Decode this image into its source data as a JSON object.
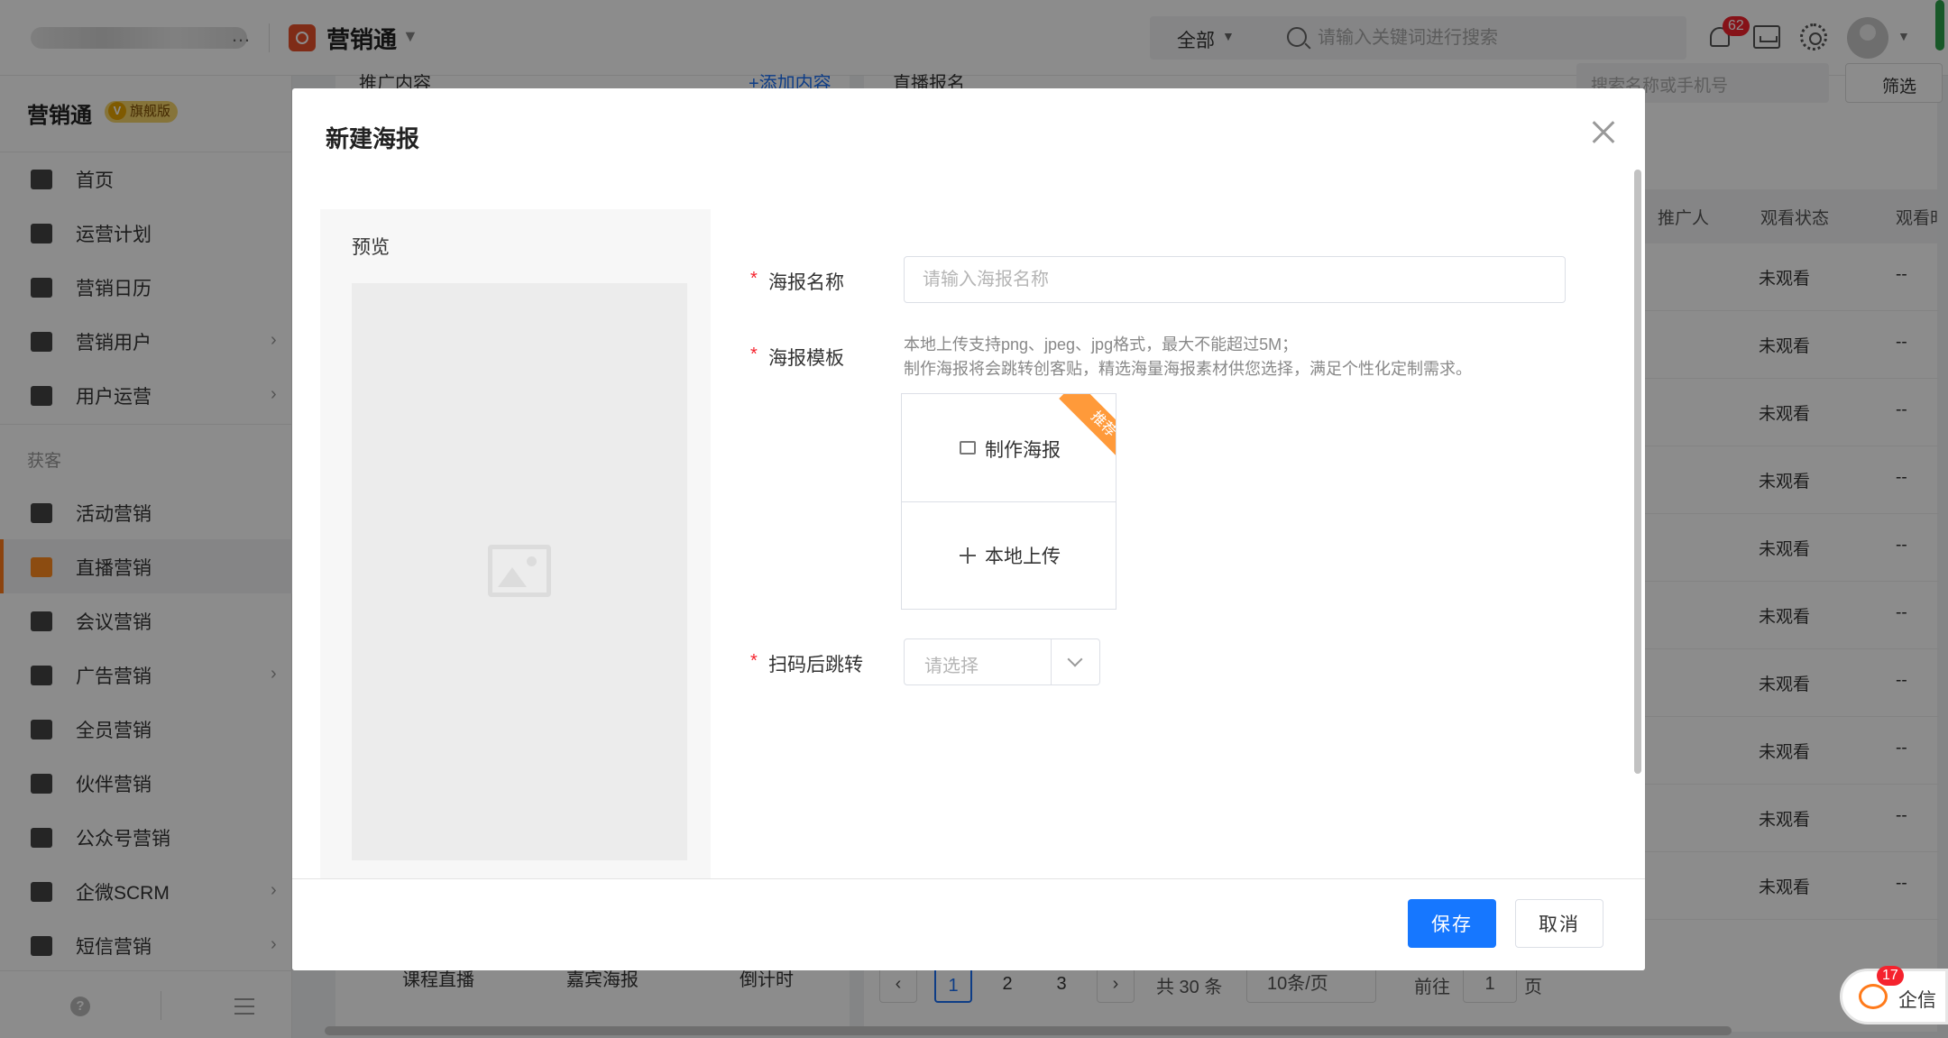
{
  "topbar": {
    "org_ellipsis": "…",
    "app_name": "营销通",
    "search_scope": "全部",
    "search_placeholder": "请输入关键词进行搜索",
    "notification_count": "62"
  },
  "sidebar": {
    "title": "营销通",
    "edition_tag": "旗舰版",
    "items_top": [
      {
        "label": "首页",
        "icon": "home-icon"
      },
      {
        "label": "运营计划",
        "icon": "plan-icon"
      },
      {
        "label": "营销日历",
        "icon": "calendar-icon"
      },
      {
        "label": "营销用户",
        "icon": "users-icon",
        "has_submenu": true
      },
      {
        "label": "用户运营",
        "icon": "user-ops-icon",
        "has_submenu": true
      }
    ],
    "group_label": "获客",
    "items_acq": [
      {
        "label": "活动营销",
        "icon": "activity-icon"
      },
      {
        "label": "直播营销",
        "icon": "live-icon",
        "active": true
      },
      {
        "label": "会议营销",
        "icon": "meeting-icon"
      },
      {
        "label": "广告营销",
        "icon": "ad-icon",
        "has_submenu": true
      },
      {
        "label": "全员营销",
        "icon": "team-icon"
      },
      {
        "label": "伙伴营销",
        "icon": "partner-icon"
      },
      {
        "label": "公众号营销",
        "icon": "wechat-icon"
      },
      {
        "label": "企微SCRM",
        "icon": "wecom-icon",
        "has_submenu": true
      },
      {
        "label": "短信营销",
        "icon": "sms-icon",
        "has_submenu": true
      }
    ]
  },
  "background": {
    "left_header": "推广内容",
    "add_content_link": "+添加内容",
    "right_header": "直播报名",
    "search_placeholder": "搜索名称或手机号",
    "filter_label": "筛选",
    "col_promoter": "推广人",
    "col_status": "观看状态",
    "col_watch_time": "观看时",
    "rows": [
      {
        "status": "未观看",
        "time": "--"
      },
      {
        "status": "未观看",
        "time": "--"
      },
      {
        "status": "未观看",
        "time": "--"
      },
      {
        "status": "未观看",
        "time": "--"
      },
      {
        "status": "未观看",
        "time": "--"
      },
      {
        "status": "未观看",
        "time": "--"
      },
      {
        "status": "未观看",
        "time": "--"
      },
      {
        "status": "未观看",
        "time": "--"
      },
      {
        "status": "未观看",
        "time": "--"
      },
      {
        "status": "未观看",
        "time": "--"
      }
    ],
    "bottom_tabs": [
      "课程直播",
      "嘉宾海报",
      "倒计时"
    ],
    "pagination": {
      "pages": [
        "1",
        "2",
        "3"
      ],
      "current": "1",
      "total": "共 30 条",
      "page_size": "10条/页",
      "goto_label": "前往",
      "goto_value": "1",
      "page_suffix": "页"
    },
    "qiwei_count": "17",
    "qiwei_label": "企信"
  },
  "modal": {
    "title": "新建海报",
    "preview_label": "预览",
    "field_name_label": "海报名称",
    "field_name_placeholder": "请输入海报名称",
    "field_template_label": "海报模板",
    "template_hint_1": "本地上传支持png、jpeg、jpg格式，最大不能超过5M；",
    "template_hint_2": "制作海报将会跳转创客贴，精选海量海报素材供您选择，满足个性化定制需求。",
    "make_poster_label": "制作海报",
    "recommend_badge": "推荐",
    "local_upload_label": "本地上传",
    "field_redirect_label": "扫码后跳转",
    "redirect_placeholder": "请选择",
    "required_mark": "*",
    "save_label": "保存",
    "cancel_label": "取消"
  }
}
